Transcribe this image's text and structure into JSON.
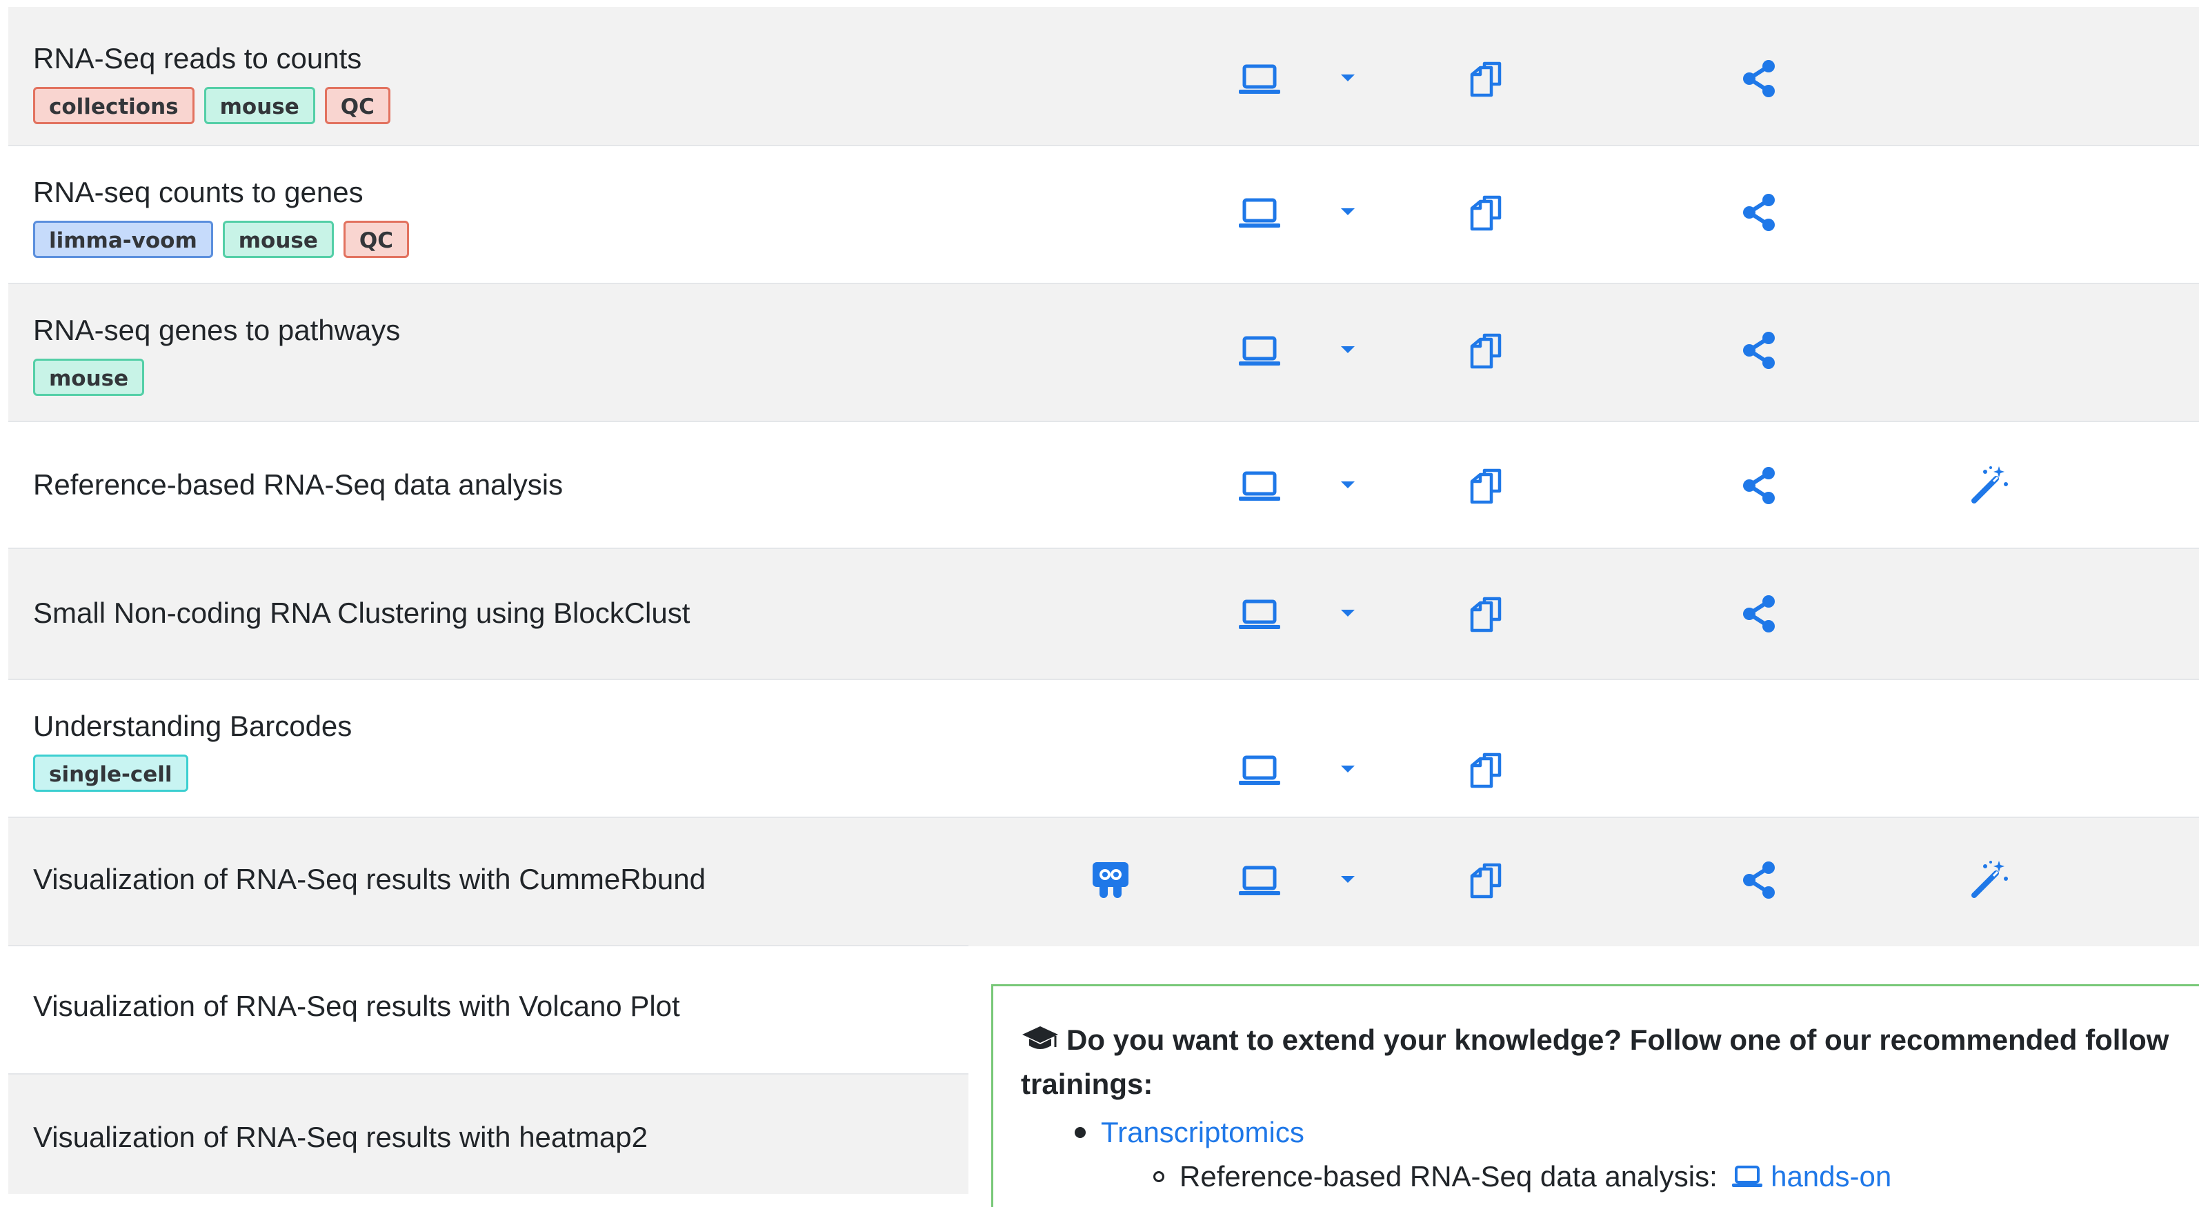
{
  "rows": [
    {
      "title": "RNA-Seq reads to counts",
      "tags": [
        "collections",
        "mouse",
        "QC"
      ]
    },
    {
      "title": "RNA-seq counts to genes",
      "tags": [
        "limma-voom",
        "mouse",
        "QC"
      ]
    },
    {
      "title": "RNA-seq genes to pathways",
      "tags": [
        "mouse"
      ]
    },
    {
      "title": "Reference-based RNA-Seq data analysis",
      "tags": []
    },
    {
      "title": "Small Non-coding RNA Clustering using BlockClust",
      "tags": []
    },
    {
      "title": "Understanding Barcodes",
      "tags": [
        "single-cell"
      ]
    },
    {
      "title": "Visualization of RNA-Seq results with CummeRbund",
      "tags": []
    },
    {
      "title": "Visualization of RNA-Seq results with Volcano Plot",
      "tags": []
    },
    {
      "title": "Visualization of RNA-Seq results with heatmap2",
      "tags": []
    }
  ],
  "followup": {
    "heading_line1": "Do you want to extend your knowledge? Follow one of our recommended follow",
    "heading_line2": "trainings:",
    "topic_link": "Transcriptomics",
    "item_text": "Reference-based RNA-Seq data analysis:",
    "item_link": "hands-on"
  },
  "icons": {
    "slides": "slides-icon",
    "hands_on": "laptop-icon",
    "dropdown": "caret-down-icon",
    "workflow": "files-icon",
    "share": "share-icon",
    "instance": "magic-wand-icon",
    "cap": "graduation-cap-icon"
  },
  "colors": {
    "accent": "#1f78e8",
    "row_alt": "#f2f2f2",
    "box_border": "#78c878"
  }
}
